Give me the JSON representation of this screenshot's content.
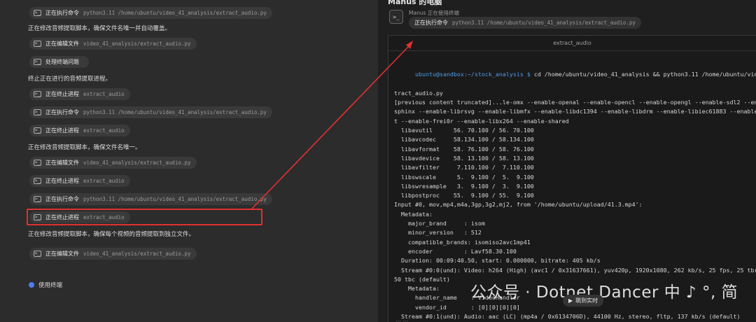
{
  "left": {
    "items": [
      {
        "type": "chip",
        "label": "正在执行命令",
        "arg": "python3.11 /home/ubuntu/video_41_analysis/extract_audio.py"
      },
      {
        "type": "note",
        "text": "正在修改音频提取脚本，确保文件名唯一并自动覆盖。"
      },
      {
        "type": "chip",
        "label": "正在编辑文件",
        "arg": "video_41_analysis/extract_audio.py"
      },
      {
        "type": "chip",
        "label": "处理终端问题",
        "arg": ""
      },
      {
        "type": "note",
        "text": "终止正在进行的音频提取进程。"
      },
      {
        "type": "chip",
        "label": "正在终止进程",
        "arg": "extract_audio"
      },
      {
        "type": "chip",
        "label": "正在执行命令",
        "arg": "python3.11 /home/ubuntu/video_41_analysis/extract_audio.py"
      },
      {
        "type": "chip",
        "label": "正在终止进程",
        "arg": "extract_audio"
      },
      {
        "type": "note",
        "text": "正在修改音频提取脚本，确保文件名唯一。"
      },
      {
        "type": "chip",
        "label": "正在编辑文件",
        "arg": "video_41_analysis/extract_audio.py"
      },
      {
        "type": "chip",
        "label": "正在终止进程",
        "arg": "extract_audio"
      },
      {
        "type": "chip",
        "label": "正在执行命令",
        "arg": "python3.11 /home/ubuntu/video_41_analysis/extract_audio.py"
      },
      {
        "type": "chip",
        "label": "正在终止进程",
        "arg": "extract_audio"
      },
      {
        "type": "note",
        "text": "正在修改音频提取脚本，确保每个视频的音频提取到独立文件。"
      },
      {
        "type": "chip",
        "label": "正在编辑文件",
        "arg": "video_41_analysis/extract_audio.py"
      }
    ],
    "using_terminal": "使用终端"
  },
  "right": {
    "title": "Manus 的电脑",
    "status": "Manus 正在使用终端",
    "cmd_label": "正在执行命令",
    "cmd_arg": "python3.11 /home/ubuntu/video_41_analysis/extract_audio.py",
    "terminal_title": "extract_audio",
    "prompt": "ubuntu@sandbox:~/stock_analysis $",
    "command": " cd /home/ubuntu/video_41_analysis && python3.11 /home/ubuntu/video_41_analysis/ex",
    "output": [
      "tract_audio.py",
      "[previous content truncated]...le-omx --enable-openal --enable-opencl --enable-opengl --enable-sdl2 --enable-po",
      "sphinx --enable-librsvg --enable-libmfx --enable-libdc1394 --enable-libdrm --enable-libiec61883 --enable-chroma",
      "t --enable-frei0r --enable-libx264 --enable-shared",
      "  libavutil      56. 70.100 / 56. 70.100",
      "  libavcodec     58.134.100 / 58.134.100",
      "  libavformat    58. 76.100 / 58. 76.100",
      "  libavdevice    58. 13.100 / 58. 13.100",
      "  libavfilter     7.110.100 /  7.110.100",
      "  libswscale      5.  9.100 /  5.  9.100",
      "  libswresample   3.  9.100 /  3.  9.100",
      "  libpostproc    55.  9.100 / 55.  9.100",
      "Input #0, mov,mp4,m4a,3gp,3g2,mj2, from '/home/ubuntu/upload/41.3.mp4':",
      "  Metadata:",
      "    major_brand     : isom",
      "    minor_version   : 512",
      "    compatible_brands: isomiso2avc1mp41",
      "    encoder         : Lavf58.30.100",
      "  Duration: 00:09:40.50, start: 0.000000, bitrate: 405 kb/s",
      "  Stream #0:0(und): Video: h264 (High) (avc1 / 0x31637661), yuv420p, 1920x1080, 262 kb/s, 25 fps, 25 tbr, 90k tb",
      "50 tbc (default)",
      "    Metadata:",
      "      handler_name    : VideoHandler",
      "      vendor_id       : [0][0][0][0]",
      "  Stream #0:1(und): Audio: aac (LC) (mp4a / 0x6134706D), 44100 Hz, stereo, fltp, 137 kb/s (default)"
    ],
    "watermark": "公众号 · Dotnet Dancer  中 ♪ °, 简",
    "jump_label": "跳到实时",
    "bottom_hint": "… …"
  },
  "colors": {
    "highlight": "#e03030",
    "prompt": "#4e9ae8",
    "accent_dot": "#4f7cf2"
  }
}
